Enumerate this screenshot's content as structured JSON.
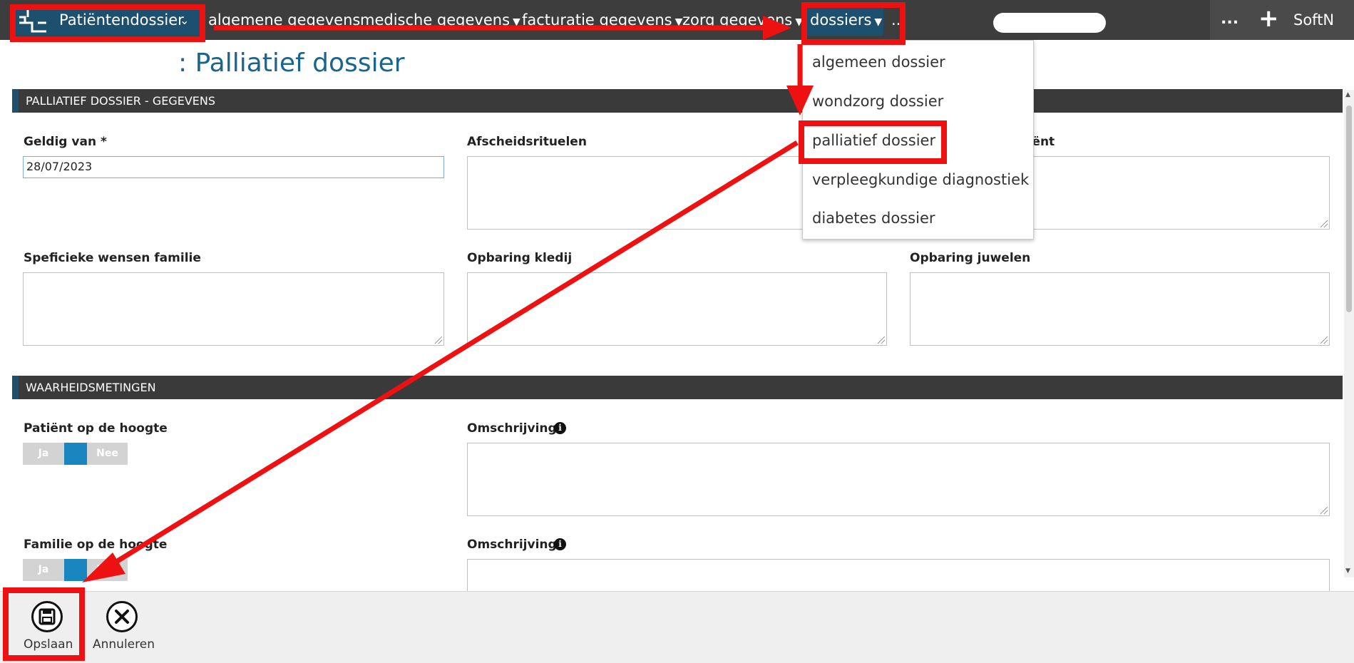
{
  "topbar": {
    "brand_label": "Patiëntendossier",
    "nav": [
      "algemene gegevens",
      "medische gegevens",
      "facturatie gegevens",
      "zorg gegevens",
      "dossiers",
      ".."
    ],
    "more": "...",
    "add": "+",
    "user": "SoftN"
  },
  "page_title": ": Palliatief dossier",
  "sections": {
    "gegevens": "PALLIATIEF DOSSIER - GEGEVENS",
    "waarheid": "WAARHEIDSMETINGEN"
  },
  "fields": {
    "geldig_van_label": "Geldig van *",
    "geldig_van_value": "28/07/2023",
    "afscheid_label": "Afscheidsrituelen",
    "patient_label_partial": "atiënt",
    "wensen_familie_label": "Speficieke wensen familie",
    "kledij_label": "Opbaring kledij",
    "juwelen_label": "Opbaring juwelen",
    "patient_hoogte_label": "Patiënt op de hoogte",
    "familie_hoogte_label": "Familie op de hoogte",
    "omschrijving_label": "Omschrijving",
    "toggle_yes": "Ja",
    "toggle_no": "Nee"
  },
  "dropdown": {
    "items": [
      "algemeen dossier",
      "wondzorg dossier",
      "palliatief dossier",
      "verpleegkundige diagnostiek",
      "diabetes dossier"
    ]
  },
  "bottombar": {
    "save_label": "Opslaan",
    "cancel_label": "Annuleren"
  },
  "colors": {
    "brand_blue": "#1d4f6e",
    "title_blue": "#1a6490",
    "toggle_blue": "#1a86c0",
    "annotation_red": "#ee1111"
  }
}
